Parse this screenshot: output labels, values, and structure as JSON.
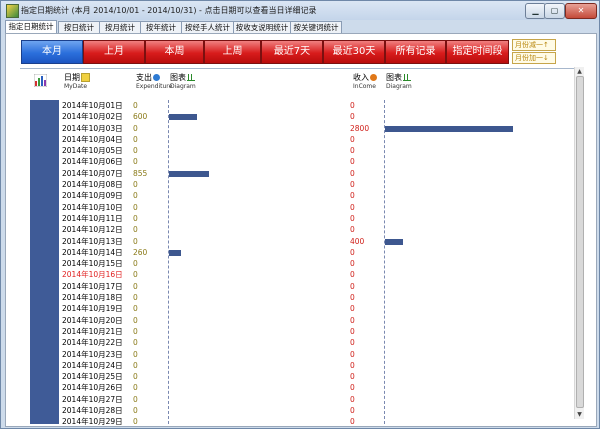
{
  "window": {
    "title": "指定日期统计 (本月 2014/10/01 - 2014/10/31) - 点击日期可以查看当日详细记录",
    "min": "▁",
    "max": "▢",
    "close": "✕"
  },
  "tabs": [
    {
      "label": "指定日期统计",
      "active": true
    },
    {
      "label": "按日统计",
      "active": false
    },
    {
      "label": "按月统计",
      "active": false
    },
    {
      "label": "按年统计",
      "active": false
    },
    {
      "label": "按经手人统计",
      "active": false
    },
    {
      "label": "按收支说明统计",
      "active": false
    },
    {
      "label": "按关键词统计",
      "active": false
    }
  ],
  "nav_buttons": [
    {
      "label": "本月",
      "active": true
    },
    {
      "label": "上月",
      "active": false
    },
    {
      "label": "本周",
      "active": false
    },
    {
      "label": "上周",
      "active": false
    },
    {
      "label": "最近7天",
      "active": false
    },
    {
      "label": "最近30天",
      "active": false
    },
    {
      "label": "所有记录",
      "active": false
    },
    {
      "label": "指定时间段",
      "active": false
    }
  ],
  "month_controls": {
    "prev": "月份减一↑",
    "next": "月份加一↓"
  },
  "headers": {
    "date": "日期",
    "date_sub": "MyDate",
    "expenditure": "支出",
    "expenditure_sub": "Expenditure",
    "exp_diagram": "图表",
    "exp_diagram_sub": "Diagram",
    "income": "收入",
    "income_sub": "InCome",
    "inc_diagram": "图表",
    "inc_diagram_sub": "Diagram"
  },
  "colors": {
    "bar": "#3d578f",
    "active_nav": "#2b6fdc",
    "nav": "#d81c1c",
    "expenditure_text": "#8a7a18",
    "income_text": "#d0201a"
  },
  "rows": [
    {
      "date": "2014年10月01日",
      "expenditure": "0",
      "income": "0",
      "exp_value": 0,
      "inc_value": 0,
      "today": false
    },
    {
      "date": "2014年10月02日",
      "expenditure": "600",
      "income": "0",
      "exp_value": 600,
      "inc_value": 0,
      "today": false
    },
    {
      "date": "2014年10月03日",
      "expenditure": "0",
      "income": "2800",
      "exp_value": 0,
      "inc_value": 2800,
      "today": false
    },
    {
      "date": "2014年10月04日",
      "expenditure": "0",
      "income": "0",
      "exp_value": 0,
      "inc_value": 0,
      "today": false
    },
    {
      "date": "2014年10月05日",
      "expenditure": "0",
      "income": "0",
      "exp_value": 0,
      "inc_value": 0,
      "today": false
    },
    {
      "date": "2014年10月06日",
      "expenditure": "0",
      "income": "0",
      "exp_value": 0,
      "inc_value": 0,
      "today": false
    },
    {
      "date": "2014年10月07日",
      "expenditure": "855",
      "income": "0",
      "exp_value": 855,
      "inc_value": 0,
      "today": false
    },
    {
      "date": "2014年10月08日",
      "expenditure": "0",
      "income": "0",
      "exp_value": 0,
      "inc_value": 0,
      "today": false
    },
    {
      "date": "2014年10月09日",
      "expenditure": "0",
      "income": "0",
      "exp_value": 0,
      "inc_value": 0,
      "today": false
    },
    {
      "date": "2014年10月10日",
      "expenditure": "0",
      "income": "0",
      "exp_value": 0,
      "inc_value": 0,
      "today": false
    },
    {
      "date": "2014年10月11日",
      "expenditure": "0",
      "income": "0",
      "exp_value": 0,
      "inc_value": 0,
      "today": false
    },
    {
      "date": "2014年10月12日",
      "expenditure": "0",
      "income": "0",
      "exp_value": 0,
      "inc_value": 0,
      "today": false
    },
    {
      "date": "2014年10月13日",
      "expenditure": "0",
      "income": "400",
      "exp_value": 0,
      "inc_value": 400,
      "today": false
    },
    {
      "date": "2014年10月14日",
      "expenditure": "260",
      "income": "0",
      "exp_value": 260,
      "inc_value": 0,
      "today": false
    },
    {
      "date": "2014年10月15日",
      "expenditure": "0",
      "income": "0",
      "exp_value": 0,
      "inc_value": 0,
      "today": false
    },
    {
      "date": "2014年10月16日",
      "expenditure": "0",
      "income": "0",
      "exp_value": 0,
      "inc_value": 0,
      "today": true
    },
    {
      "date": "2014年10月17日",
      "expenditure": "0",
      "income": "0",
      "exp_value": 0,
      "inc_value": 0,
      "today": false
    },
    {
      "date": "2014年10月18日",
      "expenditure": "0",
      "income": "0",
      "exp_value": 0,
      "inc_value": 0,
      "today": false
    },
    {
      "date": "2014年10月19日",
      "expenditure": "0",
      "income": "0",
      "exp_value": 0,
      "inc_value": 0,
      "today": false
    },
    {
      "date": "2014年10月20日",
      "expenditure": "0",
      "income": "0",
      "exp_value": 0,
      "inc_value": 0,
      "today": false
    },
    {
      "date": "2014年10月21日",
      "expenditure": "0",
      "income": "0",
      "exp_value": 0,
      "inc_value": 0,
      "today": false
    },
    {
      "date": "2014年10月22日",
      "expenditure": "0",
      "income": "0",
      "exp_value": 0,
      "inc_value": 0,
      "today": false
    },
    {
      "date": "2014年10月23日",
      "expenditure": "0",
      "income": "0",
      "exp_value": 0,
      "inc_value": 0,
      "today": false
    },
    {
      "date": "2014年10月24日",
      "expenditure": "0",
      "income": "0",
      "exp_value": 0,
      "inc_value": 0,
      "today": false
    },
    {
      "date": "2014年10月25日",
      "expenditure": "0",
      "income": "0",
      "exp_value": 0,
      "inc_value": 0,
      "today": false
    },
    {
      "date": "2014年10月26日",
      "expenditure": "0",
      "income": "0",
      "exp_value": 0,
      "inc_value": 0,
      "today": false
    },
    {
      "date": "2014年10月27日",
      "expenditure": "0",
      "income": "0",
      "exp_value": 0,
      "inc_value": 0,
      "today": false
    },
    {
      "date": "2014年10月28日",
      "expenditure": "0",
      "income": "0",
      "exp_value": 0,
      "inc_value": 0,
      "today": false
    },
    {
      "date": "2014年10月29日",
      "expenditure": "0",
      "income": "0",
      "exp_value": 0,
      "inc_value": 0,
      "today": false
    }
  ]
}
